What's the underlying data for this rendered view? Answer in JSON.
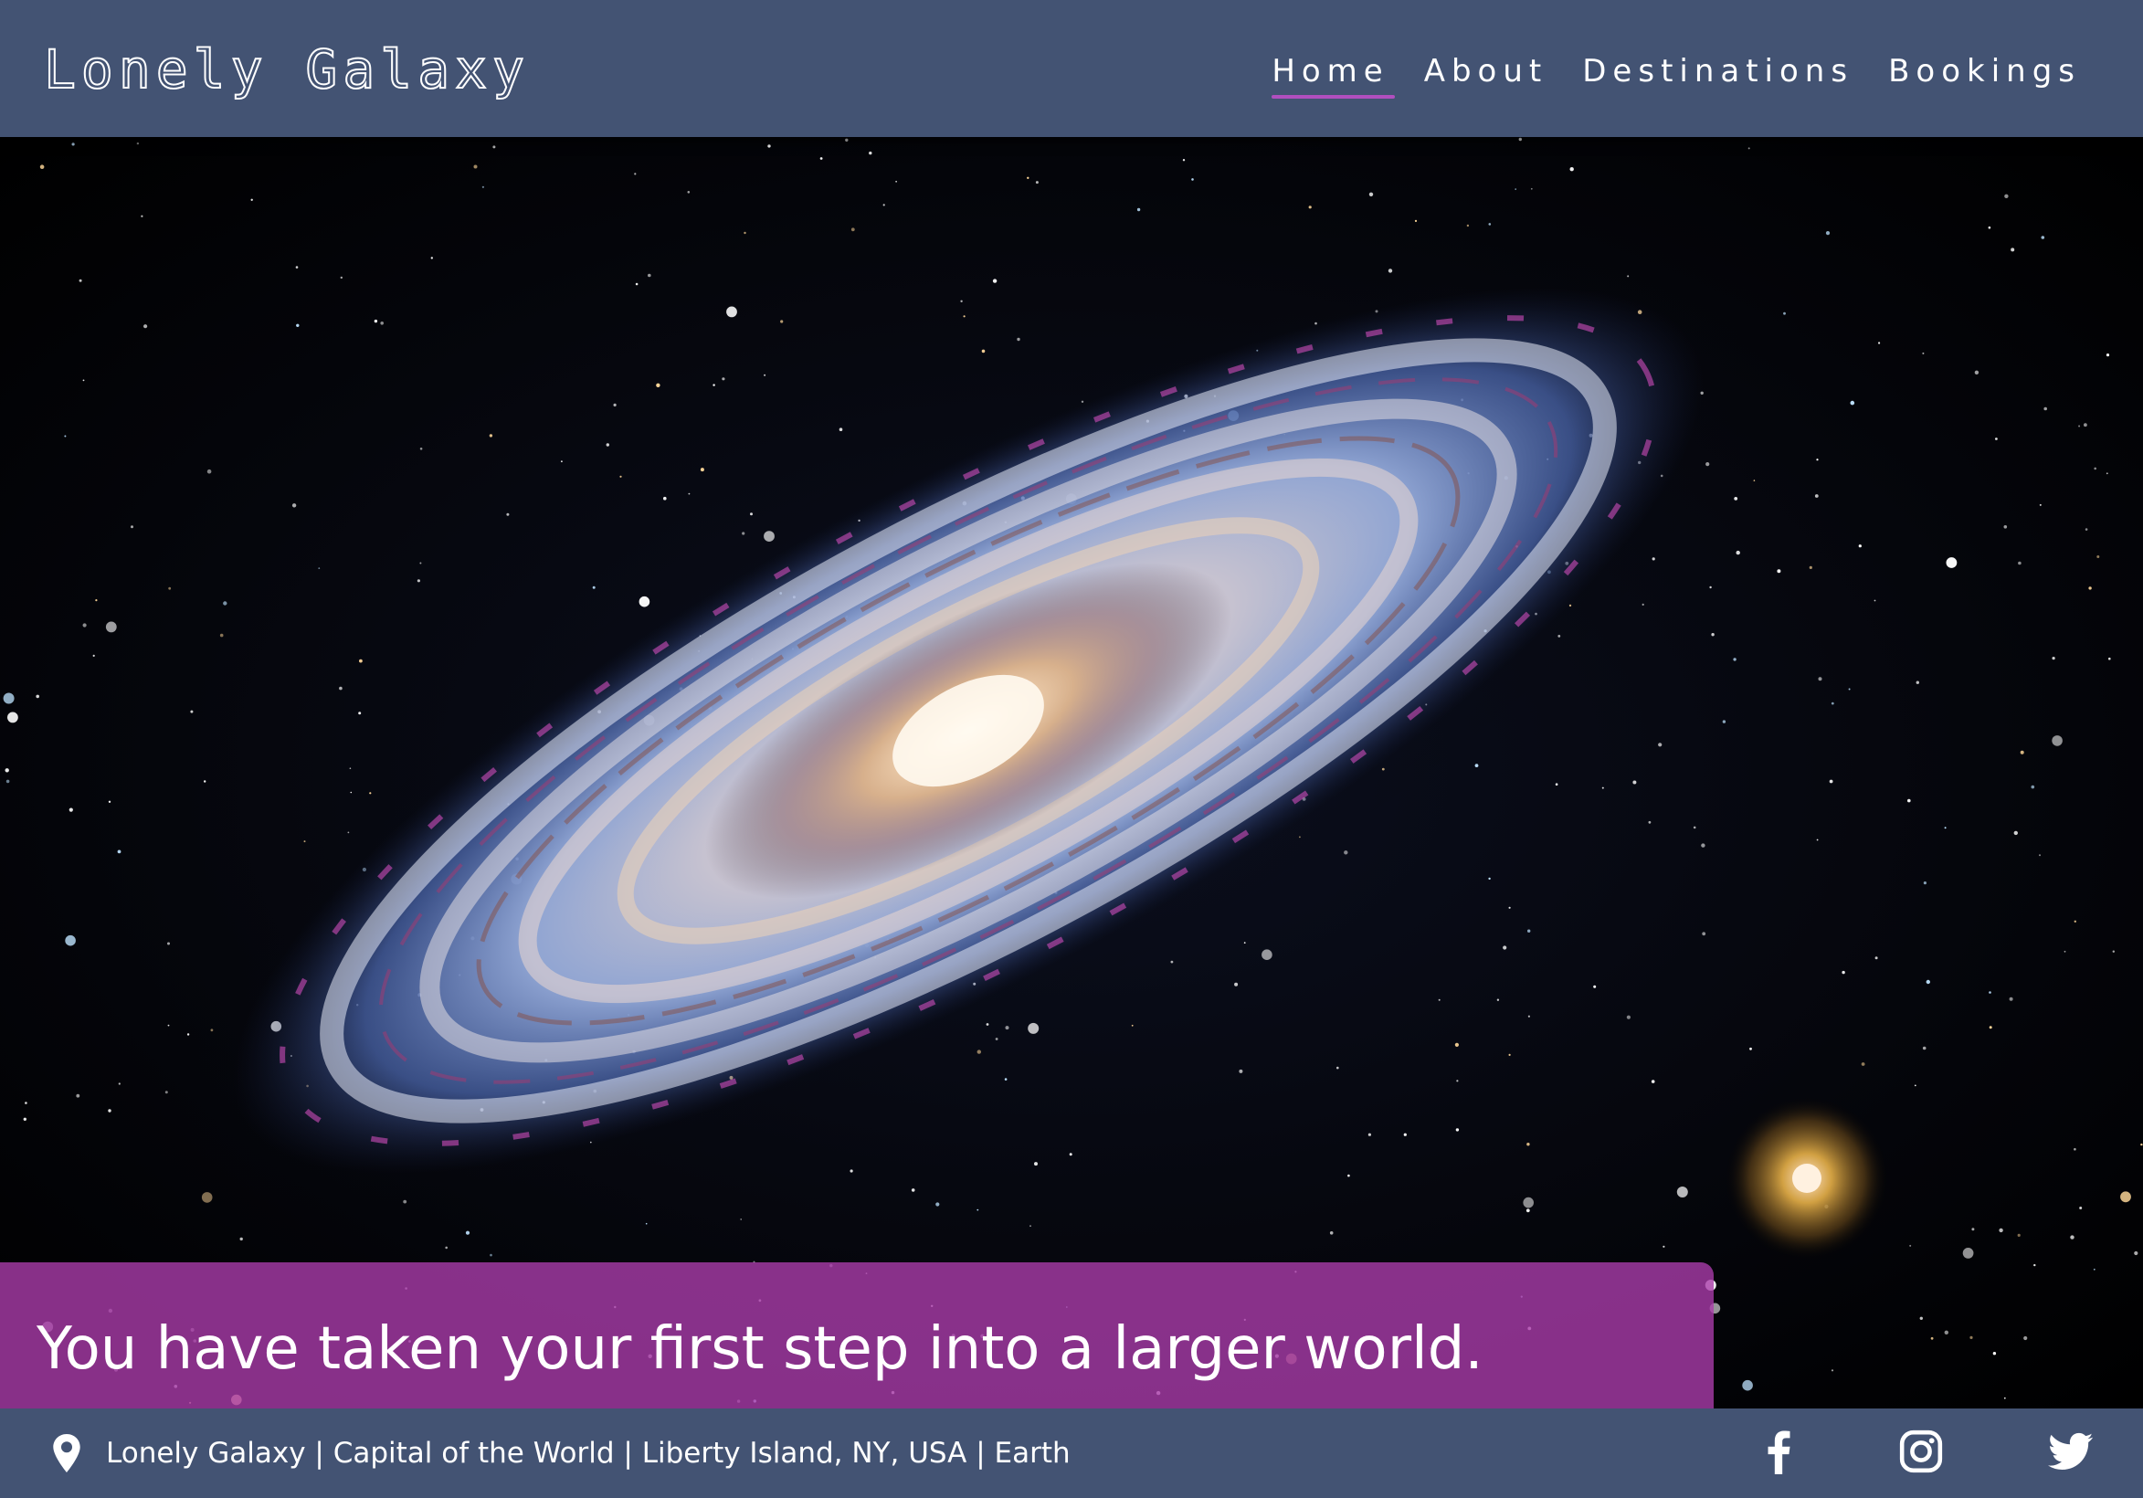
{
  "site": {
    "logo": "Lonely Galaxy"
  },
  "nav": {
    "items": [
      {
        "label": "Home",
        "active": true
      },
      {
        "label": "About",
        "active": false
      },
      {
        "label": "Destinations",
        "active": false
      },
      {
        "label": "Bookings",
        "active": false
      }
    ]
  },
  "hero": {
    "image": "spiral-galaxy-image",
    "tagline": "You have taken your first step into a larger world."
  },
  "footer": {
    "location_icon": "map-pin-icon",
    "address": "Lonely Galaxy | Capital of the World | Liberty Island, NY, USA | Earth",
    "social": [
      {
        "name": "facebook-icon"
      },
      {
        "name": "instagram-icon"
      },
      {
        "name": "twitter-icon"
      }
    ]
  },
  "colors": {
    "header_bg": "#435373",
    "tagline_bg": "#aa3caa",
    "active_underline": "#b14fbf",
    "text": "#ffffff"
  }
}
